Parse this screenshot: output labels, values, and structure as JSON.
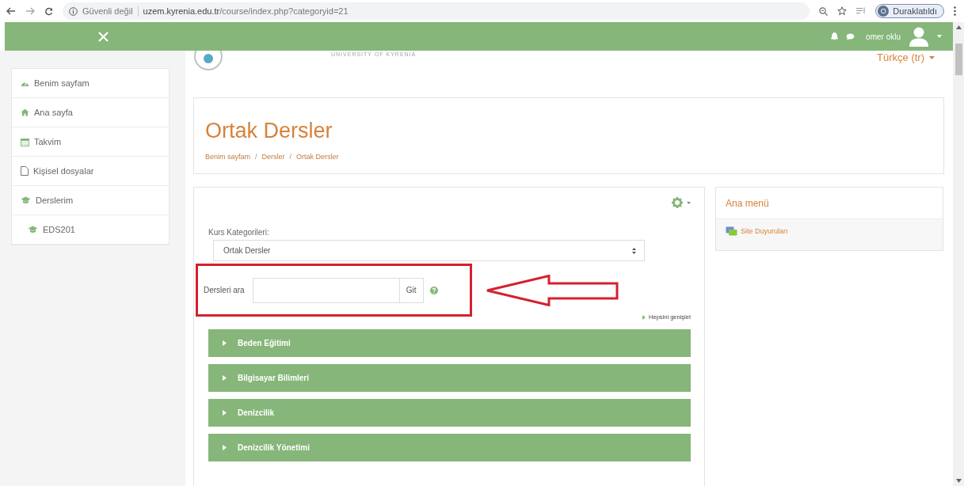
{
  "browser": {
    "url_warning": "Güvenli değil",
    "url_host": "uzem.kyrenia.edu.tr",
    "url_path": "/course/index.php?categoryid=21",
    "profile_initial": "O",
    "profile_status": "Duraklatıldı"
  },
  "navbar": {
    "user_name": "omer oklu"
  },
  "logo": {
    "subtitle": "UNIVERSITY OF KYRENIA"
  },
  "language": "Türkçe (tr)",
  "sidebar": {
    "items": [
      {
        "label": "Benim sayfam",
        "kind": "dashboard"
      },
      {
        "label": "Ana sayfa",
        "kind": "home"
      },
      {
        "label": "Takvim",
        "kind": "calendar"
      },
      {
        "label": "Kişisel dosyalar",
        "kind": "file"
      },
      {
        "label": "Derslerim",
        "kind": "course",
        "children": [
          {
            "label": "EDS201",
            "kind": "course"
          }
        ]
      }
    ]
  },
  "page_header": {
    "title": "Ortak Dersler",
    "breadcrumb": [
      {
        "kind": "link",
        "text": "Benim sayfam"
      },
      {
        "kind": "separator",
        "text": "/"
      },
      {
        "kind": "link",
        "text": "Dersler"
      },
      {
        "kind": "separator",
        "text": "/"
      },
      {
        "kind": "link",
        "text": "Ortak Dersler"
      }
    ]
  },
  "course_box": {
    "category_label": "Kurs Kategorileri:",
    "category_value": "Ortak Dersler",
    "search_label": "Dersleri ara",
    "search_button": "Git",
    "expand_all": "Hepsini genişlet",
    "categories": [
      {
        "name": "Beden Eğitimi",
        "expanded": false
      },
      {
        "name": "Bilgisayar Bilimleri",
        "expanded": false
      },
      {
        "name": "Denizcilik",
        "expanded": false
      },
      {
        "name": "Denizcilik Yönetimi",
        "expanded": false
      }
    ]
  },
  "block": {
    "title": "Ana menü",
    "items": [
      {
        "label": "Site Duyuruları"
      }
    ]
  }
}
